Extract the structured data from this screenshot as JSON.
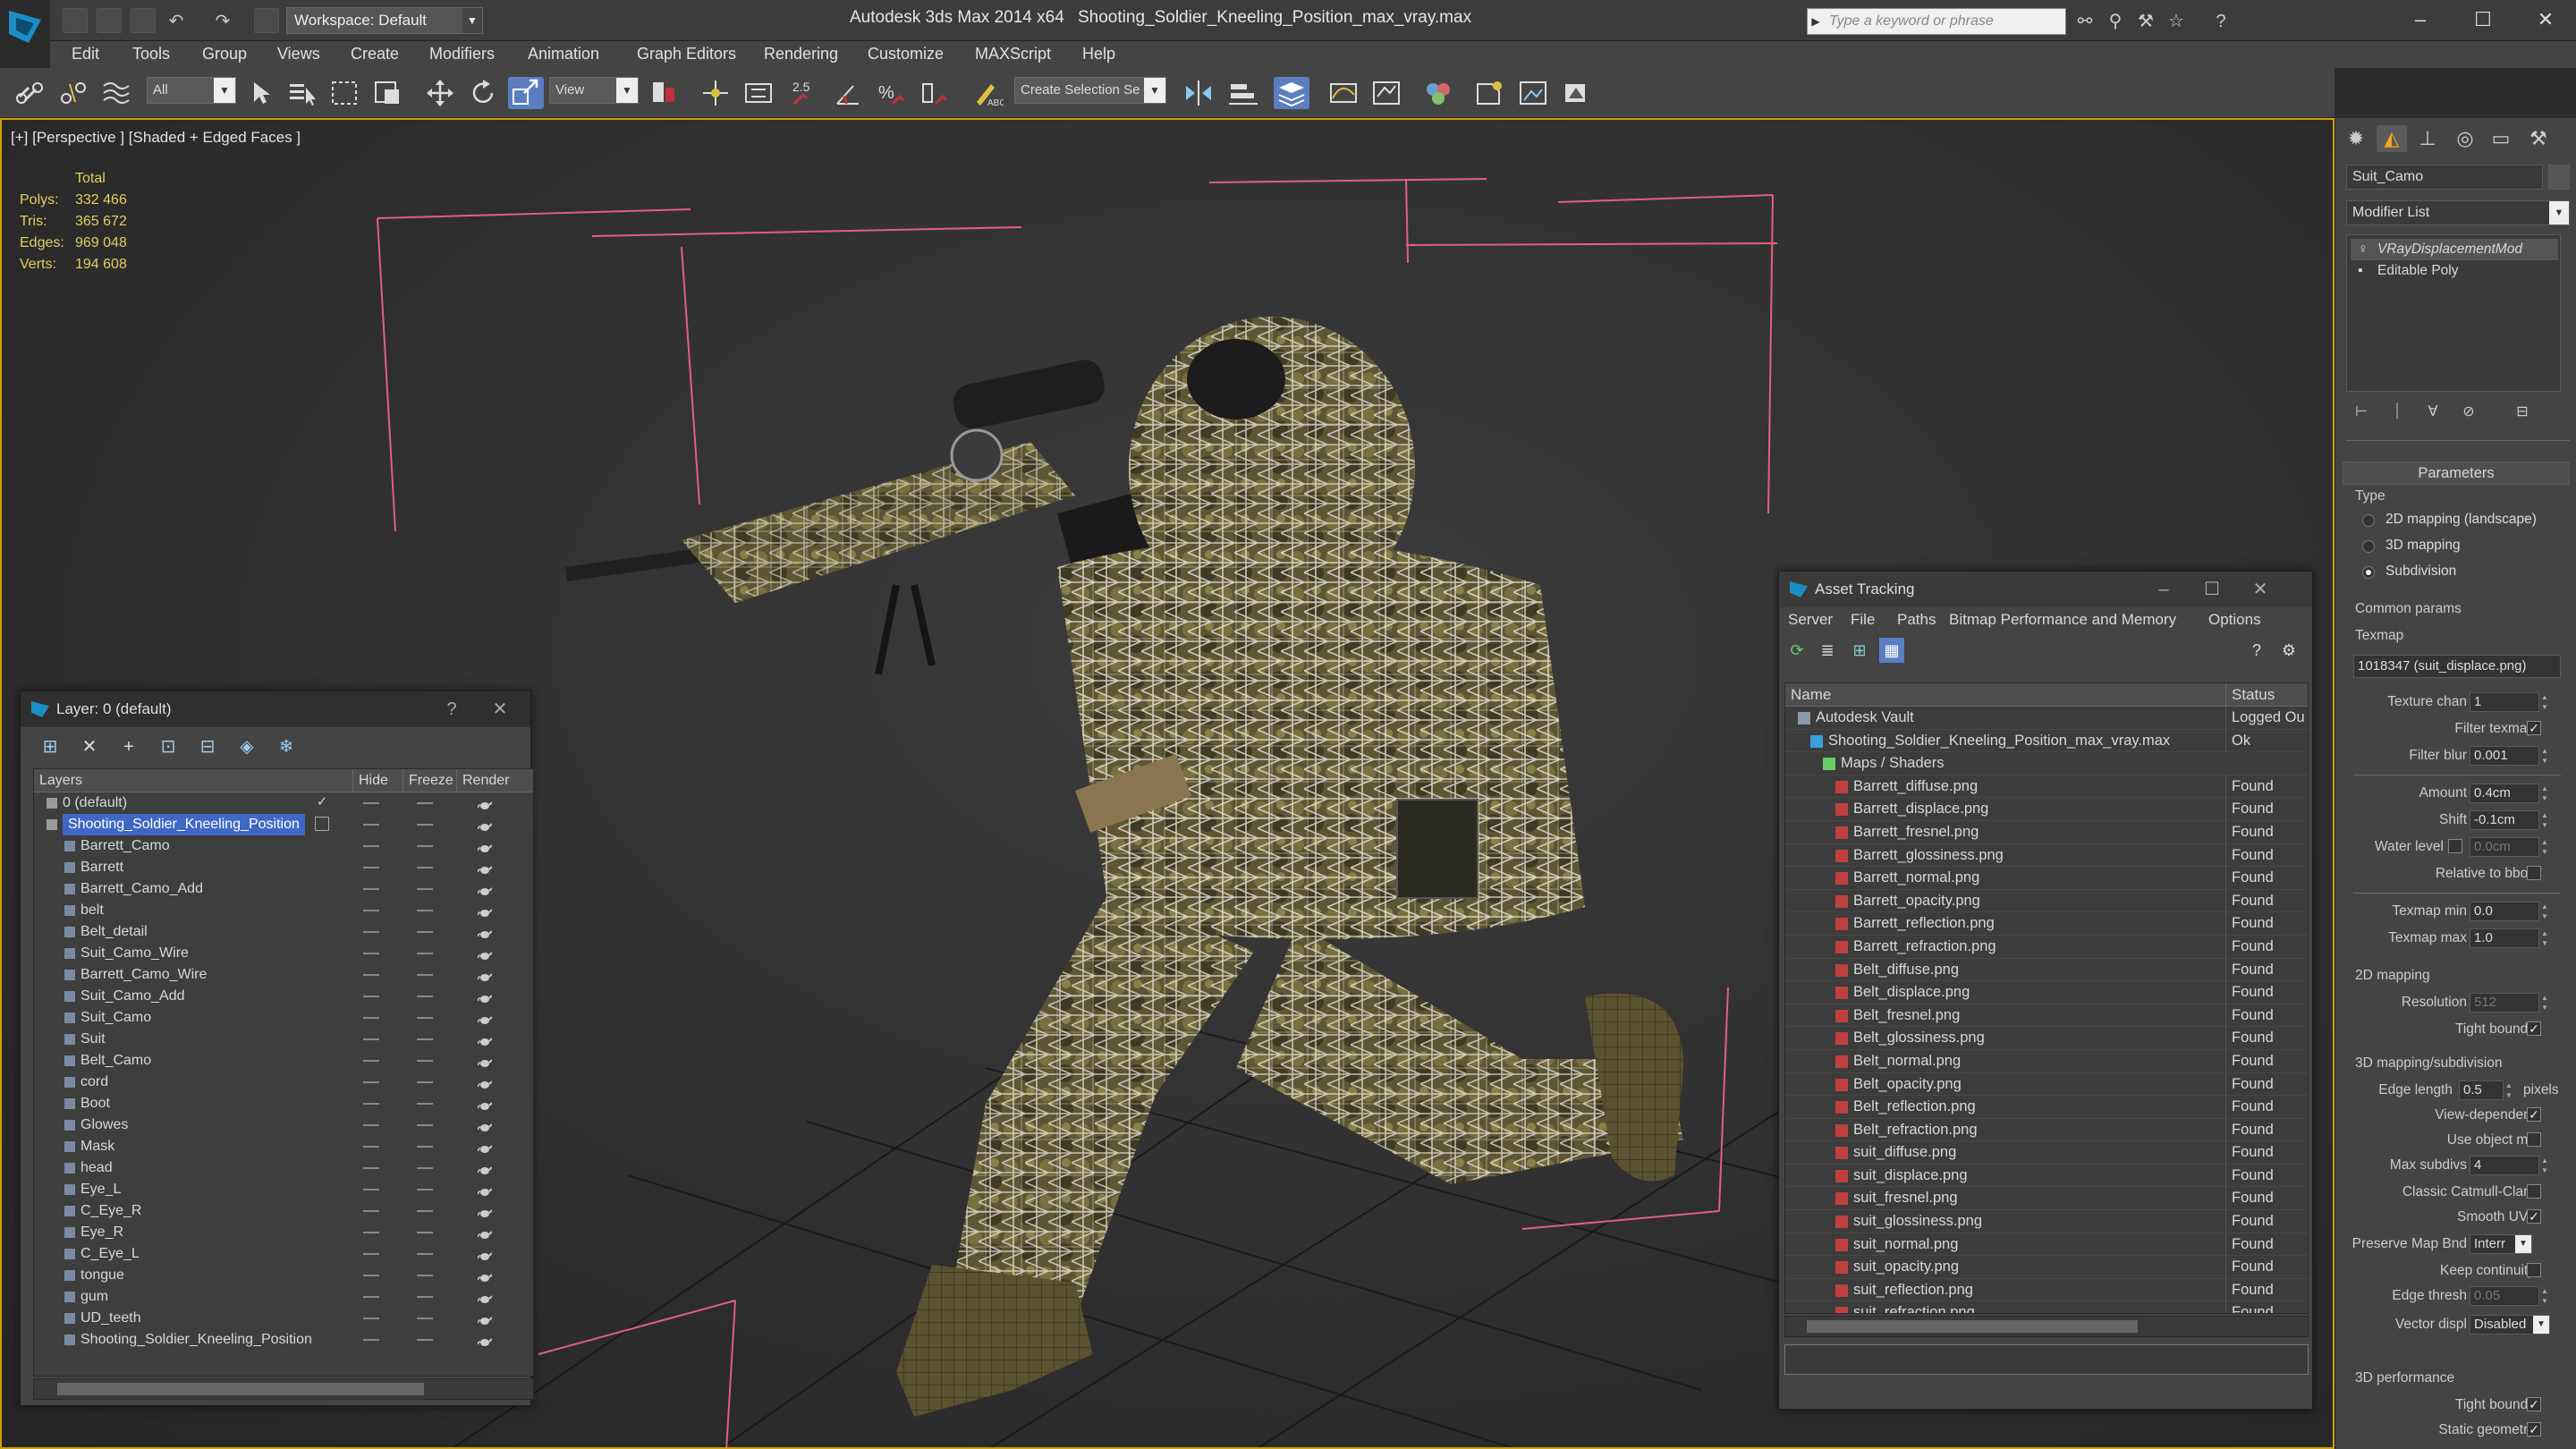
{
  "titlebar": {
    "workspace": "Workspace: Default",
    "app_title": "Autodesk 3ds Max  2014 x64",
    "file_title": "Shooting_Soldier_Kneeling_Position_max_vray.max",
    "search_placeholder": "Type a keyword or phrase"
  },
  "menu": [
    "Edit",
    "Tools",
    "Group",
    "Views",
    "Create",
    "Modifiers",
    "Animation",
    "Graph Editors",
    "Rendering",
    "Customize",
    "MAXScript",
    "Help"
  ],
  "toolbar": {
    "selection_filter": "All",
    "ref_coord": "View",
    "snap_label": "2.5",
    "named_selection": "Create Selection Se"
  },
  "viewport": {
    "label": "[+] [Perspective ] [Shaded + Edged Faces ]",
    "stats_header": "Total",
    "stats": [
      {
        "label": "Polys:",
        "value": "332 466"
      },
      {
        "label": "Tris:",
        "value": "365 672"
      },
      {
        "label": "Edges:",
        "value": "969 048"
      },
      {
        "label": "Verts:",
        "value": "194 608"
      }
    ]
  },
  "layer_window": {
    "title": "Layer: 0 (default)",
    "columns": [
      "Layers",
      "Hide",
      "Freeze",
      "Render"
    ],
    "rows": [
      {
        "name": "0 (default)",
        "level": 0,
        "checked": true
      },
      {
        "name": "Shooting_Soldier_Kneeling_Position",
        "level": 0,
        "selected": true
      },
      {
        "name": "Barrett_Camo",
        "level": 1
      },
      {
        "name": "Barrett",
        "level": 1
      },
      {
        "name": "Barrett_Camo_Add",
        "level": 1
      },
      {
        "name": "belt",
        "level": 1
      },
      {
        "name": "Belt_detail",
        "level": 1
      },
      {
        "name": "Suit_Camo_Wire",
        "level": 1
      },
      {
        "name": "Barrett_Camo_Wire",
        "level": 1
      },
      {
        "name": "Suit_Camo_Add",
        "level": 1
      },
      {
        "name": "Suit_Camo",
        "level": 1
      },
      {
        "name": "Suit",
        "level": 1
      },
      {
        "name": "Belt_Camo",
        "level": 1
      },
      {
        "name": "cord",
        "level": 1
      },
      {
        "name": "Boot",
        "level": 1
      },
      {
        "name": "Glowes",
        "level": 1
      },
      {
        "name": "Mask",
        "level": 1
      },
      {
        "name": "head",
        "level": 1
      },
      {
        "name": "Eye_L",
        "level": 1
      },
      {
        "name": "C_Eye_R",
        "level": 1
      },
      {
        "name": "Eye_R",
        "level": 1
      },
      {
        "name": "C_Eye_L",
        "level": 1
      },
      {
        "name": "tongue",
        "level": 1
      },
      {
        "name": "gum",
        "level": 1
      },
      {
        "name": "UD_teeth",
        "level": 1
      },
      {
        "name": "Shooting_Soldier_Kneeling_Position",
        "level": 1
      }
    ]
  },
  "asset_window": {
    "title": "Asset Tracking",
    "menu": [
      "Server",
      "File",
      "Paths",
      "Bitmap Performance and Memory",
      "Options"
    ],
    "columns": [
      "Name",
      "Status"
    ],
    "rows": [
      {
        "name": "Autodesk Vault",
        "status": "Logged Ou",
        "level": 0,
        "kind": "vault"
      },
      {
        "name": "Shooting_Soldier_Kneeling_Position_max_vray.max",
        "status": "Ok",
        "level": 1,
        "kind": "max"
      },
      {
        "name": "Maps / Shaders",
        "status": "",
        "level": 2,
        "kind": "maps"
      },
      {
        "name": "Barrett_diffuse.png",
        "status": "Found",
        "level": 3,
        "kind": "png"
      },
      {
        "name": "Barrett_displace.png",
        "status": "Found",
        "level": 3,
        "kind": "png"
      },
      {
        "name": "Barrett_fresnel.png",
        "status": "Found",
        "level": 3,
        "kind": "png"
      },
      {
        "name": "Barrett_glossiness.png",
        "status": "Found",
        "level": 3,
        "kind": "png"
      },
      {
        "name": "Barrett_normal.png",
        "status": "Found",
        "level": 3,
        "kind": "png"
      },
      {
        "name": "Barrett_opacity.png",
        "status": "Found",
        "level": 3,
        "kind": "png"
      },
      {
        "name": "Barrett_reflection.png",
        "status": "Found",
        "level": 3,
        "kind": "png"
      },
      {
        "name": "Barrett_refraction.png",
        "status": "Found",
        "level": 3,
        "kind": "png"
      },
      {
        "name": "Belt_diffuse.png",
        "status": "Found",
        "level": 3,
        "kind": "png"
      },
      {
        "name": "Belt_displace.png",
        "status": "Found",
        "level": 3,
        "kind": "png"
      },
      {
        "name": "Belt_fresnel.png",
        "status": "Found",
        "level": 3,
        "kind": "png"
      },
      {
        "name": "Belt_glossiness.png",
        "status": "Found",
        "level": 3,
        "kind": "png"
      },
      {
        "name": "Belt_normal.png",
        "status": "Found",
        "level": 3,
        "kind": "png"
      },
      {
        "name": "Belt_opacity.png",
        "status": "Found",
        "level": 3,
        "kind": "png"
      },
      {
        "name": "Belt_reflection.png",
        "status": "Found",
        "level": 3,
        "kind": "png"
      },
      {
        "name": "Belt_refraction.png",
        "status": "Found",
        "level": 3,
        "kind": "png"
      },
      {
        "name": "suit_diffuse.png",
        "status": "Found",
        "level": 3,
        "kind": "png"
      },
      {
        "name": "suit_displace.png",
        "status": "Found",
        "level": 3,
        "kind": "png"
      },
      {
        "name": "suit_fresnel.png",
        "status": "Found",
        "level": 3,
        "kind": "png"
      },
      {
        "name": "suit_glossiness.png",
        "status": "Found",
        "level": 3,
        "kind": "png"
      },
      {
        "name": "suit_normal.png",
        "status": "Found",
        "level": 3,
        "kind": "png"
      },
      {
        "name": "suit_opacity.png",
        "status": "Found",
        "level": 3,
        "kind": "png"
      },
      {
        "name": "suit_reflection.png",
        "status": "Found",
        "level": 3,
        "kind": "png"
      },
      {
        "name": "suit_refraction.png",
        "status": "Found",
        "level": 3,
        "kind": "png"
      }
    ]
  },
  "command_panel": {
    "object_name": "Suit_Camo",
    "modifier_list": "Modifier List",
    "stack": [
      "VRayDisplacementMod",
      "Editable Poly"
    ],
    "rollout": "Parameters",
    "type_group": "Type",
    "type_options": [
      "2D mapping (landscape)",
      "3D mapping",
      "Subdivision"
    ],
    "type_selected": 2,
    "common_group": "Common params",
    "texmap_label": "Texmap",
    "texmap_value": "1018347 (suit_displace.png)",
    "texture_chan_label": "Texture chan",
    "texture_chan": "1",
    "filter_texmap_label": "Filter texmap",
    "filter_blur_label": "Filter blur",
    "filter_blur": "0.001",
    "amount_label": "Amount",
    "amount": "0.4cm",
    "shift_label": "Shift",
    "shift": "-0.1cm",
    "water_level_label": "Water level",
    "water_level": "0.0cm",
    "relative_bbox_label": "Relative to bbox",
    "texmap_min_label": "Texmap min",
    "texmap_min": "0.0",
    "texmap_max_label": "Texmap max",
    "texmap_max": "1.0",
    "mapping2d_group": "2D mapping",
    "resolution_label": "Resolution",
    "resolution": "512",
    "tight_bounds_label": "Tight bounds",
    "subdiv_group": "3D mapping/subdivision",
    "edge_length_label": "Edge length",
    "edge_length": "0.5",
    "pixels_label": "pixels",
    "view_dependent_label": "View-dependent",
    "use_object_mtl_label": "Use object mtl",
    "max_subdivs_label": "Max subdivs",
    "max_subdivs": "4",
    "catmull_label": "Classic Catmull-Clark",
    "smooth_uvs_label": "Smooth UVs",
    "preserve_map_label": "Preserve Map Bnd",
    "preserve_map": "Interr",
    "keep_continuity_label": "Keep continuity",
    "edge_thresh_label": "Edge thresh",
    "edge_thresh": "0.05",
    "vector_displ_label": "Vector displ",
    "vector_displ": "Disabled",
    "perf_group": "3D performance",
    "tight_bounds2_label": "Tight bounds",
    "static_geometry_label": "Static geometry"
  }
}
